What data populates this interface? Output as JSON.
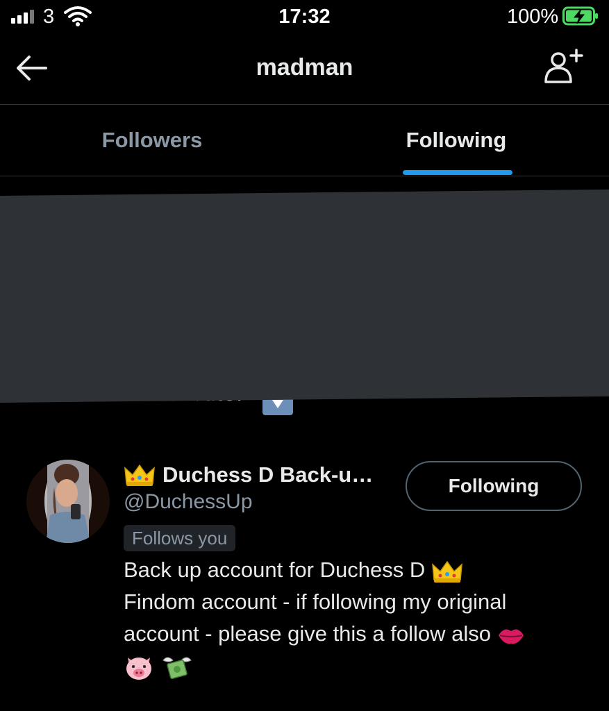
{
  "status_bar": {
    "carrier": "3",
    "time": "17:32",
    "battery_percent": "100%"
  },
  "header": {
    "title": "madman"
  },
  "tabs": [
    {
      "label": "Followers",
      "active": false
    },
    {
      "label": "Following",
      "active": true
    }
  ],
  "redacted_user": {
    "partial_bio": "dm! tribute."
  },
  "user": {
    "name_emoji": "crown",
    "name": "Duchess D Back-u…",
    "handle": "@DuchessUp",
    "follows_you": "Follows you",
    "follow_button": "Following",
    "bio_lines": [
      "Back up account for Duchess D",
      "Findom account - if following my original",
      "account - please give this a follow also"
    ]
  },
  "colors": {
    "accent": "#1d9bf0",
    "secondary_text": "#8b98a5",
    "redaction": "#2e3135"
  }
}
